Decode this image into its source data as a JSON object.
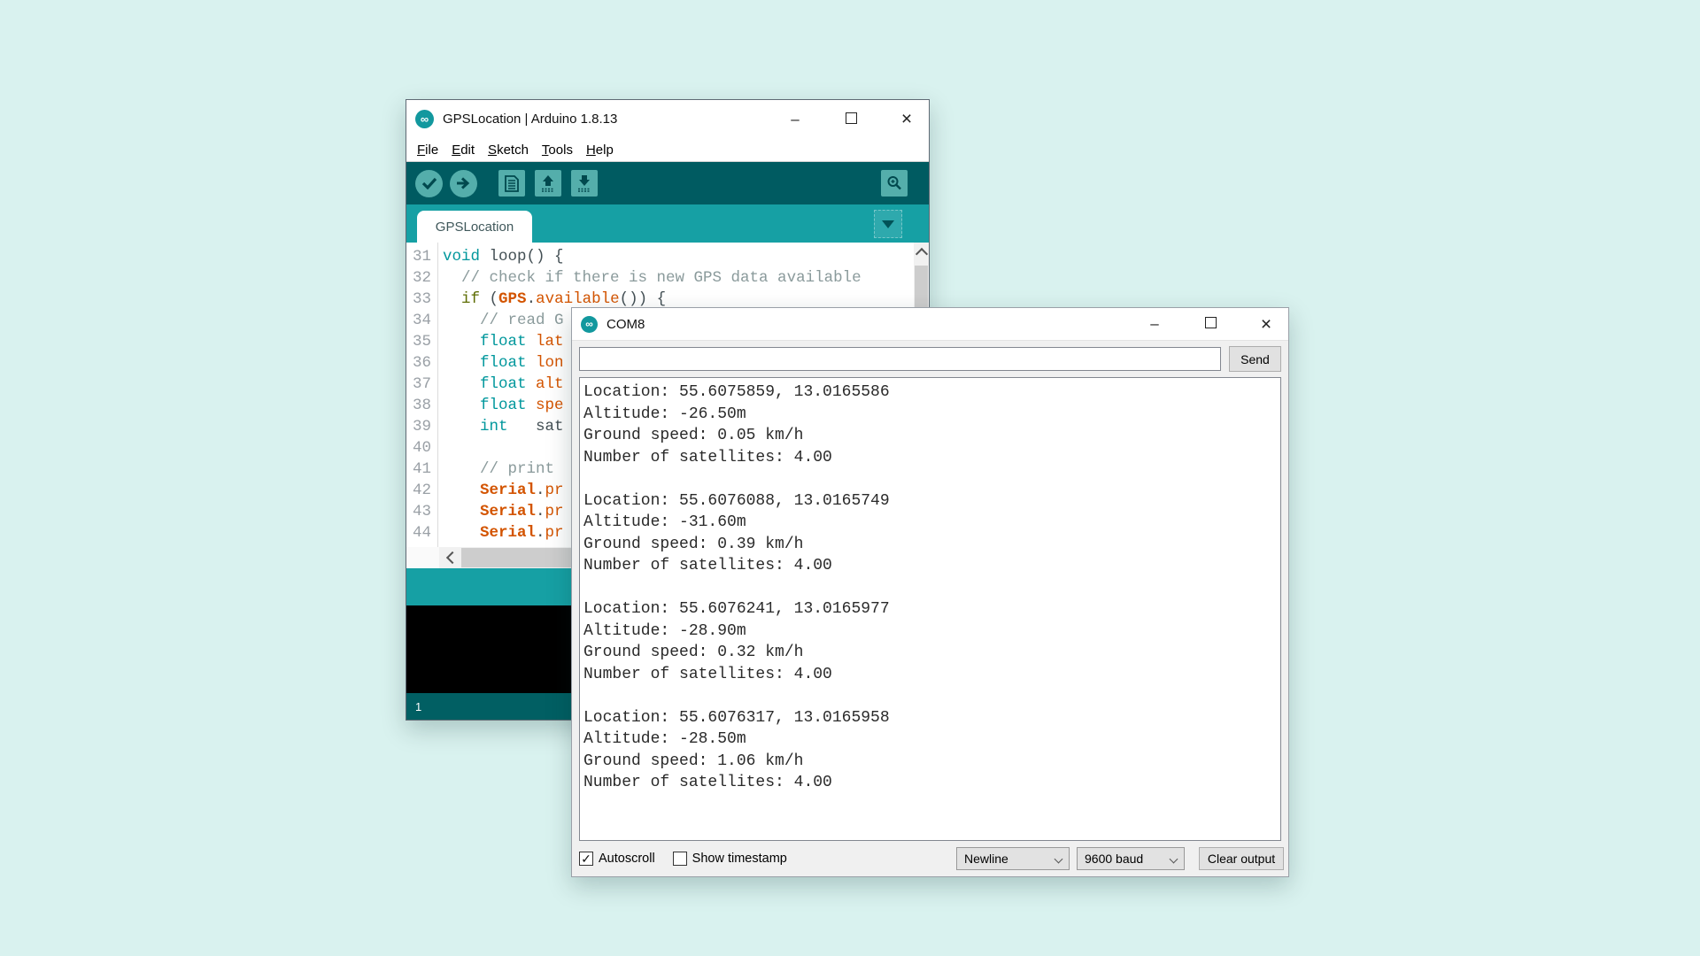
{
  "ide": {
    "title": "GPSLocation | Arduino 1.8.13",
    "app_icon_glyph": "∞",
    "menu_items": [
      "File",
      "Edit",
      "Sketch",
      "Tools",
      "Help"
    ],
    "toolbar_buttons": [
      "verify",
      "upload",
      "new-sketch",
      "open",
      "save",
      "serial-monitor"
    ],
    "tab_label": "GPSLocation",
    "status_line_number": "1",
    "code_lines": [
      {
        "n": "31",
        "tokens": [
          [
            "void",
            "kw"
          ],
          [
            " loop() {",
            "pl"
          ]
        ]
      },
      {
        "n": "32",
        "tokens": [
          [
            "  // check if there is new GPS data available",
            "com"
          ]
        ]
      },
      {
        "n": "33",
        "tokens": [
          [
            "  ",
            "pl"
          ],
          [
            "if",
            "ctl"
          ],
          [
            " (",
            "pl"
          ],
          [
            "GPS",
            "cls"
          ],
          [
            ".",
            "pl"
          ],
          [
            "available",
            "fn"
          ],
          [
            "()) {",
            "pl"
          ]
        ]
      },
      {
        "n": "34",
        "tokens": [
          [
            "    // read G",
            "com"
          ]
        ]
      },
      {
        "n": "35",
        "tokens": [
          [
            "    ",
            "pl"
          ],
          [
            "float",
            "kw"
          ],
          [
            " ",
            "pl"
          ],
          [
            "lat",
            "fn"
          ]
        ]
      },
      {
        "n": "36",
        "tokens": [
          [
            "    ",
            "pl"
          ],
          [
            "float",
            "kw"
          ],
          [
            " ",
            "pl"
          ],
          [
            "lon",
            "fn"
          ]
        ]
      },
      {
        "n": "37",
        "tokens": [
          [
            "    ",
            "pl"
          ],
          [
            "float",
            "kw"
          ],
          [
            " ",
            "pl"
          ],
          [
            "alt",
            "fn"
          ]
        ]
      },
      {
        "n": "38",
        "tokens": [
          [
            "    ",
            "pl"
          ],
          [
            "float",
            "kw"
          ],
          [
            " ",
            "pl"
          ],
          [
            "spe",
            "fn"
          ]
        ]
      },
      {
        "n": "39",
        "tokens": [
          [
            "    ",
            "pl"
          ],
          [
            "int",
            "kw"
          ],
          [
            "   sat",
            "pl"
          ]
        ]
      },
      {
        "n": "40",
        "tokens": []
      },
      {
        "n": "41",
        "tokens": [
          [
            "    // print",
            "com"
          ]
        ]
      },
      {
        "n": "42",
        "tokens": [
          [
            "    ",
            "pl"
          ],
          [
            "Serial",
            "cls"
          ],
          [
            ".",
            "pl"
          ],
          [
            "pr",
            "fn"
          ]
        ]
      },
      {
        "n": "43",
        "tokens": [
          [
            "    ",
            "pl"
          ],
          [
            "Serial",
            "cls"
          ],
          [
            ".",
            "pl"
          ],
          [
            "pr",
            "fn"
          ]
        ]
      },
      {
        "n": "44",
        "tokens": [
          [
            "    ",
            "pl"
          ],
          [
            "Serial",
            "cls"
          ],
          [
            ".",
            "pl"
          ],
          [
            "pr",
            "fn"
          ]
        ]
      }
    ]
  },
  "serial_monitor": {
    "title": "COM8",
    "app_icon_glyph": "∞",
    "input_value": "",
    "send_label": "Send",
    "output_lines": [
      "Location: 55.6075859, 13.0165586",
      "Altitude: -26.50m",
      "Ground speed: 0.05 km/h",
      "Number of satellites: 4.00",
      "",
      "Location: 55.6076088, 13.0165749",
      "Altitude: -31.60m",
      "Ground speed: 0.39 km/h",
      "Number of satellites: 4.00",
      "",
      "Location: 55.6076241, 13.0165977",
      "Altitude: -28.90m",
      "Ground speed: 0.32 km/h",
      "Number of satellites: 4.00",
      "",
      "Location: 55.6076317, 13.0165958",
      "Altitude: -28.50m",
      "Ground speed: 1.06 km/h",
      "Number of satellites: 4.00"
    ],
    "autoscroll_label": "Autoscroll",
    "autoscroll_checked": true,
    "autoscroll_check_glyph": "✓",
    "show_timestamp_label": "Show timestamp",
    "show_timestamp_checked": false,
    "line_ending_selected": "Newline",
    "baud_selected": "9600 baud",
    "clear_button_label": "Clear output"
  },
  "colors": {
    "page_background": "#d9f2ef",
    "toolbar_teal_dark": "#005b61",
    "tabbar_teal": "#16a0a4",
    "button_teal_light": "#54aeab",
    "bottombar_teal": "#015f63",
    "keyword_teal": "#00979c",
    "control_olive": "#5e6d03",
    "function_orange": "#d35400",
    "comment_gray": "#8a9a9b",
    "console_black": "#000000"
  }
}
